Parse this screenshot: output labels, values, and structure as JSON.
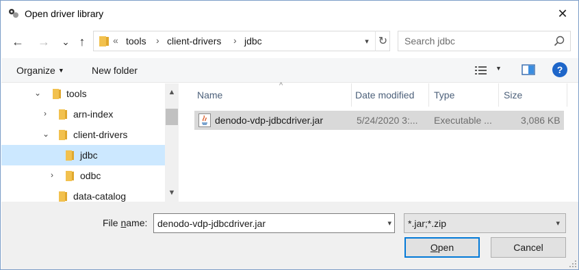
{
  "window": {
    "title": "Open driver library",
    "close_glyph": "✕"
  },
  "nav": {
    "back_glyph": "←",
    "forward_glyph": "→",
    "recent_glyph": "⌄",
    "up_glyph": "↑"
  },
  "address": {
    "overflow_glyph": "«",
    "crumbs": [
      "tools",
      "client-drivers",
      "jdbc"
    ],
    "separator": "›",
    "dropdown_glyph": "▾",
    "refresh_glyph": "↻"
  },
  "search": {
    "placeholder": "Search jdbc"
  },
  "toolbar": {
    "organize_label": "Organize",
    "caret": "▼",
    "new_folder_label": "New folder",
    "view_caret": "▼",
    "help_label": "?"
  },
  "tree": {
    "items": [
      {
        "label": "tools",
        "chevron": "⌄"
      },
      {
        "label": "arn-index",
        "chevron": "›"
      },
      {
        "label": "client-drivers",
        "chevron": "⌄"
      },
      {
        "label": "jdbc",
        "chevron": ""
      },
      {
        "label": "odbc",
        "chevron": "›"
      },
      {
        "label": "data-catalog",
        "chevron": ""
      }
    ],
    "scroll_up": "▲",
    "scroll_down": "▼"
  },
  "filelist": {
    "sort_caret": "^",
    "columns": [
      "Name",
      "Date modified",
      "Type",
      "Size"
    ],
    "rows": [
      {
        "name": "denodo-vdp-jdbcdriver.jar",
        "date": "5/24/2020 3:...",
        "type": "Executable ...",
        "size": "3,086 KB"
      }
    ]
  },
  "bottom": {
    "file_name_label_pre": "File ",
    "file_name_label_accel": "n",
    "file_name_label_post": "ame:",
    "file_name_value": "denodo-vdp-jdbcdriver.jar",
    "dropdown_glyph": "▾",
    "file_type_value": "*.jar;*.zip",
    "open_accel": "O",
    "open_rest": "pen",
    "cancel_label": "Cancel"
  },
  "colors": {
    "selection": "#cce8ff",
    "row_highlight": "#d9d9d9",
    "accent": "#0078d7",
    "folder": "#f2c14e"
  }
}
